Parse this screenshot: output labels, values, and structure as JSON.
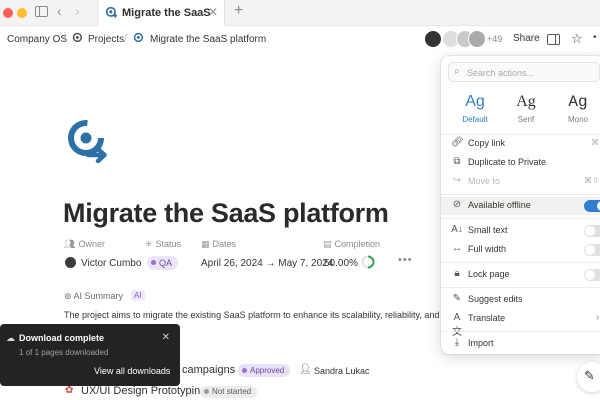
{
  "window": {
    "tab_title": "Migrate the SaaS platform",
    "tab_close": "✕",
    "new_tab": "+"
  },
  "breadcrumb": {
    "items": [
      "Company OS",
      "Projects",
      "Migrate the SaaS platform"
    ],
    "separator": "/"
  },
  "topbar": {
    "collaborator_count": "+49",
    "share_label": "Share"
  },
  "page": {
    "title": "Migrate the SaaS platform",
    "properties": {
      "owner_label": "Owner",
      "status_label": "Status",
      "dates_label": "Dates",
      "completion_label": "Completion",
      "owner": "Victor Cumbo",
      "status": "QA",
      "dates": "April 26, 2024 → May 7, 2024",
      "completion": "50.00%",
      "completion_value": 0.5
    },
    "ai_summary": {
      "label": "AI Summary",
      "badge": "AI",
      "text": "The project aims to migrate the existing SaaS platform to enhance its scalability, reliability, and perfor"
    },
    "rows": [
      {
        "name": "campaigns",
        "status": "Approved",
        "assignee": "Sandra Lukac"
      },
      {
        "name": "UX/UI Design Prototyping",
        "status": "Not started"
      }
    ]
  },
  "toast": {
    "title": "Download complete",
    "subtitle": "1 of 1 pages downloaded",
    "button": "View all downloads",
    "close": "✕"
  },
  "menu": {
    "search_placeholder": "Search actions...",
    "fonts": [
      {
        "sample": "Ag",
        "name": "Default",
        "selected": true
      },
      {
        "sample": "Ag",
        "name": "Serif",
        "selected": false
      },
      {
        "sample": "Ag",
        "name": "Mono",
        "selected": false
      }
    ],
    "items": {
      "copy_link": "Copy link",
      "duplicate": "Duplicate to Private",
      "move_to": "Move to",
      "available_offline": "Available offline",
      "small_text": "Small text",
      "full_width": "Full width",
      "lock_page": "Lock page",
      "suggest_edits": "Suggest edits",
      "translate": "Translate",
      "import": "Import"
    },
    "shortcuts": {
      "copy_link": "⌘",
      "move_to": "⌘⇧"
    },
    "toggles": {
      "available_offline": true,
      "small_text": false,
      "full_width": false,
      "lock_page": false
    }
  },
  "colors": {
    "accent": "#2f7fce",
    "status_purple": "#6b4aa6",
    "toast_bg": "#232323"
  }
}
